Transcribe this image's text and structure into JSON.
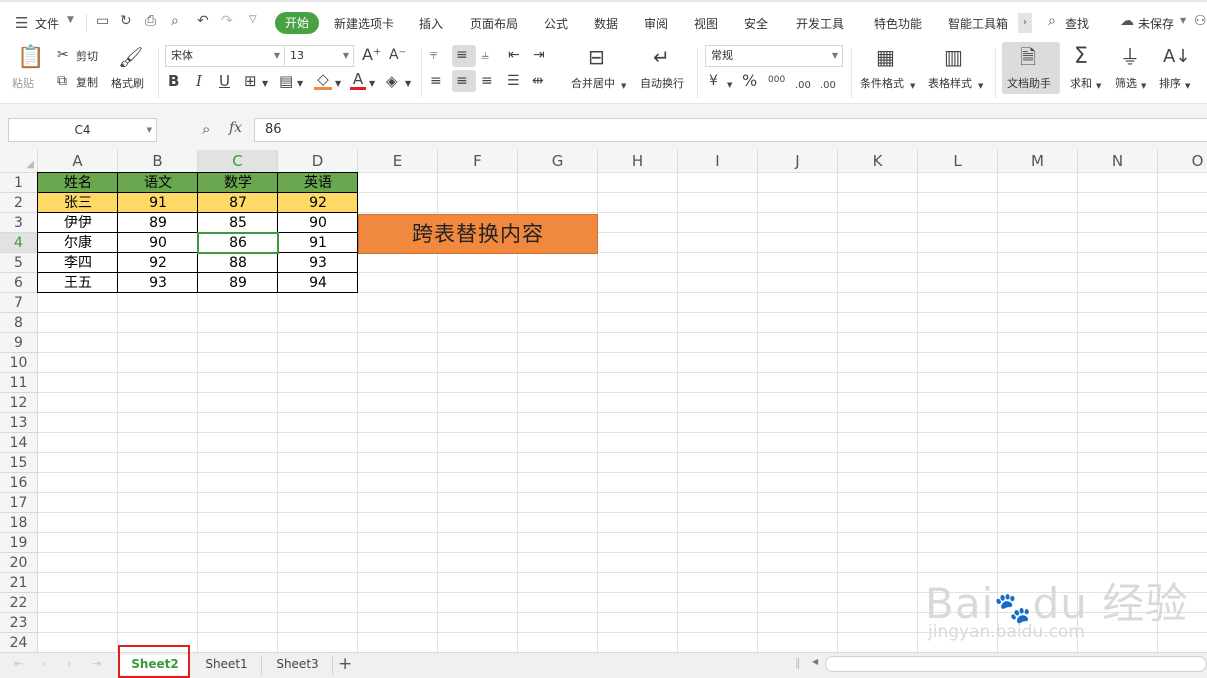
{
  "menu": {
    "file": "文件",
    "tabs": [
      "开始",
      "新建选项卡",
      "插入",
      "页面布局",
      "公式",
      "数据",
      "审阅",
      "视图",
      "安全",
      "开发工具",
      "特色功能",
      "智能工具箱"
    ],
    "search": "查找",
    "save_status": "未保存"
  },
  "ribbon": {
    "paste": "粘贴",
    "cut": "剪切",
    "copy": "复制",
    "format_painter": "格式刷",
    "font_name": "宋体",
    "font_size": "13",
    "number_format": "常规",
    "merge_center": "合并居中",
    "wrap_text": "自动换行",
    "conditional_format": "条件格式",
    "table_style": "表格样式",
    "doc_assistant": "文档助手",
    "sum": "求和",
    "filter": "筛选",
    "sort": "排序",
    "bold": "B",
    "italic": "I",
    "underline": "U",
    "font_color_letter": "A",
    "percent": "%",
    "thousands": "000",
    "inc_decimal": ".00",
    "dec_decimal": ".00"
  },
  "formula_bar": {
    "cell_ref": "C4",
    "fx_label": "fx",
    "value": "86"
  },
  "columns": [
    "A",
    "B",
    "C",
    "D",
    "E",
    "F",
    "G",
    "H",
    "I",
    "J",
    "K",
    "L",
    "M",
    "N",
    "O"
  ],
  "rows": [
    "1",
    "2",
    "3",
    "4",
    "5",
    "6",
    "7",
    "8",
    "9",
    "10",
    "11",
    "12",
    "13",
    "14",
    "15",
    "16",
    "17",
    "18",
    "19",
    "20",
    "21",
    "22",
    "23",
    "24"
  ],
  "table": {
    "header": [
      "姓名",
      "语文",
      "数学",
      "英语"
    ],
    "rows": [
      [
        "张三",
        "91",
        "87",
        "92"
      ],
      [
        "伊伊",
        "89",
        "85",
        "90"
      ],
      [
        "尔康",
        "90",
        "86",
        "91"
      ],
      [
        "李四",
        "92",
        "88",
        "93"
      ],
      [
        "王五",
        "93",
        "89",
        "94"
      ]
    ]
  },
  "button_cell": "跨表替换内容",
  "sheet_tabs": [
    "Sheet2",
    "Sheet1",
    "Sheet3"
  ],
  "add_sheet": "+",
  "colors": {
    "accent": "#48a243",
    "header_fill": "#6aa84f",
    "row2_fill": "#ffd966",
    "button_fill": "#f0883d",
    "selection_border": "#3e9a3e",
    "tab_highlight": "#e01e1e"
  }
}
